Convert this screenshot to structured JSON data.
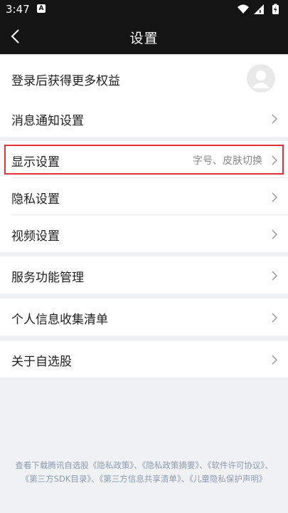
{
  "status_bar": {
    "time": "3:47",
    "app_badge": "A",
    "icons": [
      "wifi-icon",
      "signal-icon",
      "battery-icon"
    ]
  },
  "header": {
    "title": "设置",
    "back_icon": "chevron-left-icon"
  },
  "login": {
    "label": "登录后获得更多权益",
    "avatar_icon": "user-icon"
  },
  "menu": {
    "notifications": {
      "label": "消息通知设置"
    },
    "display": {
      "label": "显示设置",
      "hint": "字号、皮肤切换"
    },
    "privacy": {
      "label": "隐私设置"
    },
    "video": {
      "label": "视频设置"
    },
    "services": {
      "label": "服务功能管理"
    },
    "personal_info": {
      "label": "个人信息收集清单"
    },
    "about": {
      "label": "关于自选股"
    }
  },
  "footer": {
    "prefix": "查看下载腾讯自选股",
    "sep1": "、",
    "sep2": "、",
    "sep3": "、",
    "sep4": "、",
    "link1": "《隐私政策》",
    "link2": "《隐私政策摘要》",
    "link3": "《软件许可协议》",
    "link4": "《第三方SDK目录》",
    "link5": "《第三方信息共享清单》",
    "link6": "《儿童隐私保护声明》"
  },
  "colors": {
    "background": "#f0f1f3",
    "header": "#141414",
    "highlight": "#e0323a",
    "link": "#8b9bb3"
  }
}
